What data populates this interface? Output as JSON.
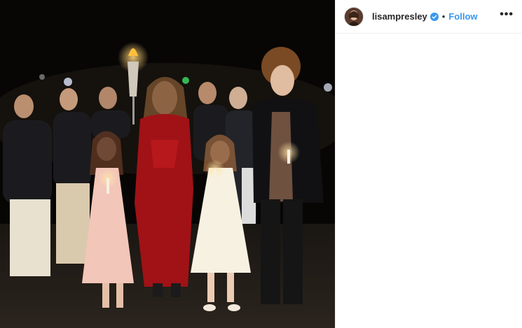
{
  "post": {
    "username": "lisampresley",
    "separator": "•",
    "follow_label": "Follow",
    "more_label": "•••"
  },
  "icons": {
    "verified": "verified-badge-icon",
    "more": "more-options-icon"
  },
  "colors": {
    "accent": "#3897f0",
    "text": "#262626",
    "border": "#efefef"
  }
}
